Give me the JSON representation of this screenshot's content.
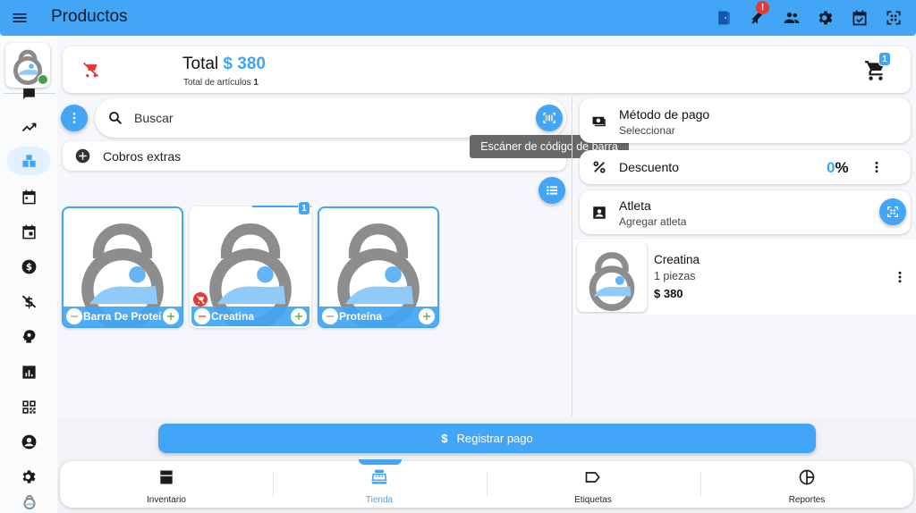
{
  "appbar": {
    "title": "Productos",
    "notification_count": "!",
    "action_icons": [
      "door-icon",
      "whistle-icon",
      "people-icon",
      "gear-icon",
      "calendar-check-icon",
      "qr-scan-icon"
    ]
  },
  "rail": {
    "items": [
      "chat-icon",
      "trending-up-icon",
      "boxes-icon",
      "calendar-icon",
      "calendar-today-icon",
      "dollar-circle-icon",
      "money-off-icon",
      "head-bulb-icon",
      "bar-chart-icon",
      "qr-code-icon",
      "account-circle-icon",
      "settings-icon"
    ],
    "active_index": 2
  },
  "total": {
    "label": "Total",
    "amount": "$ 380",
    "sub_label": "Total de artículos",
    "sub_count": "1",
    "cart_badge": "1"
  },
  "search": {
    "placeholder": "Buscar"
  },
  "extras": {
    "label": "Cobros extras"
  },
  "tooltip": {
    "text": "Escáner de código de barra"
  },
  "products": [
    {
      "name": "Barra De Proteína",
      "badge": ""
    },
    {
      "name": "Creatina",
      "badge": "1"
    },
    {
      "name": "Proteína",
      "badge": ""
    }
  ],
  "payment": {
    "title": "Método de pago",
    "subtitle": "Seleccionar"
  },
  "discount": {
    "title": "Descuento",
    "value": "0",
    "unit": "%"
  },
  "athlete": {
    "title": "Atleta",
    "subtitle": "Agregar atleta"
  },
  "cart_item": {
    "name": "Creatina",
    "quantity": "1 piezas",
    "price": "$ 380"
  },
  "register": {
    "dollar": "$",
    "label": "Registrar pago"
  },
  "bottom_nav": {
    "items": [
      {
        "label": "Inventario",
        "icon": "inventory-icon"
      },
      {
        "label": "Tienda",
        "icon": "register-icon"
      },
      {
        "label": "Etiquetas",
        "icon": "label-icon"
      },
      {
        "label": "Reportes",
        "icon": "pie-chart-icon"
      }
    ],
    "active_index": 1
  },
  "colors": {
    "accent": "#42a5f5",
    "danger": "#e53935",
    "success": "#43a047"
  }
}
